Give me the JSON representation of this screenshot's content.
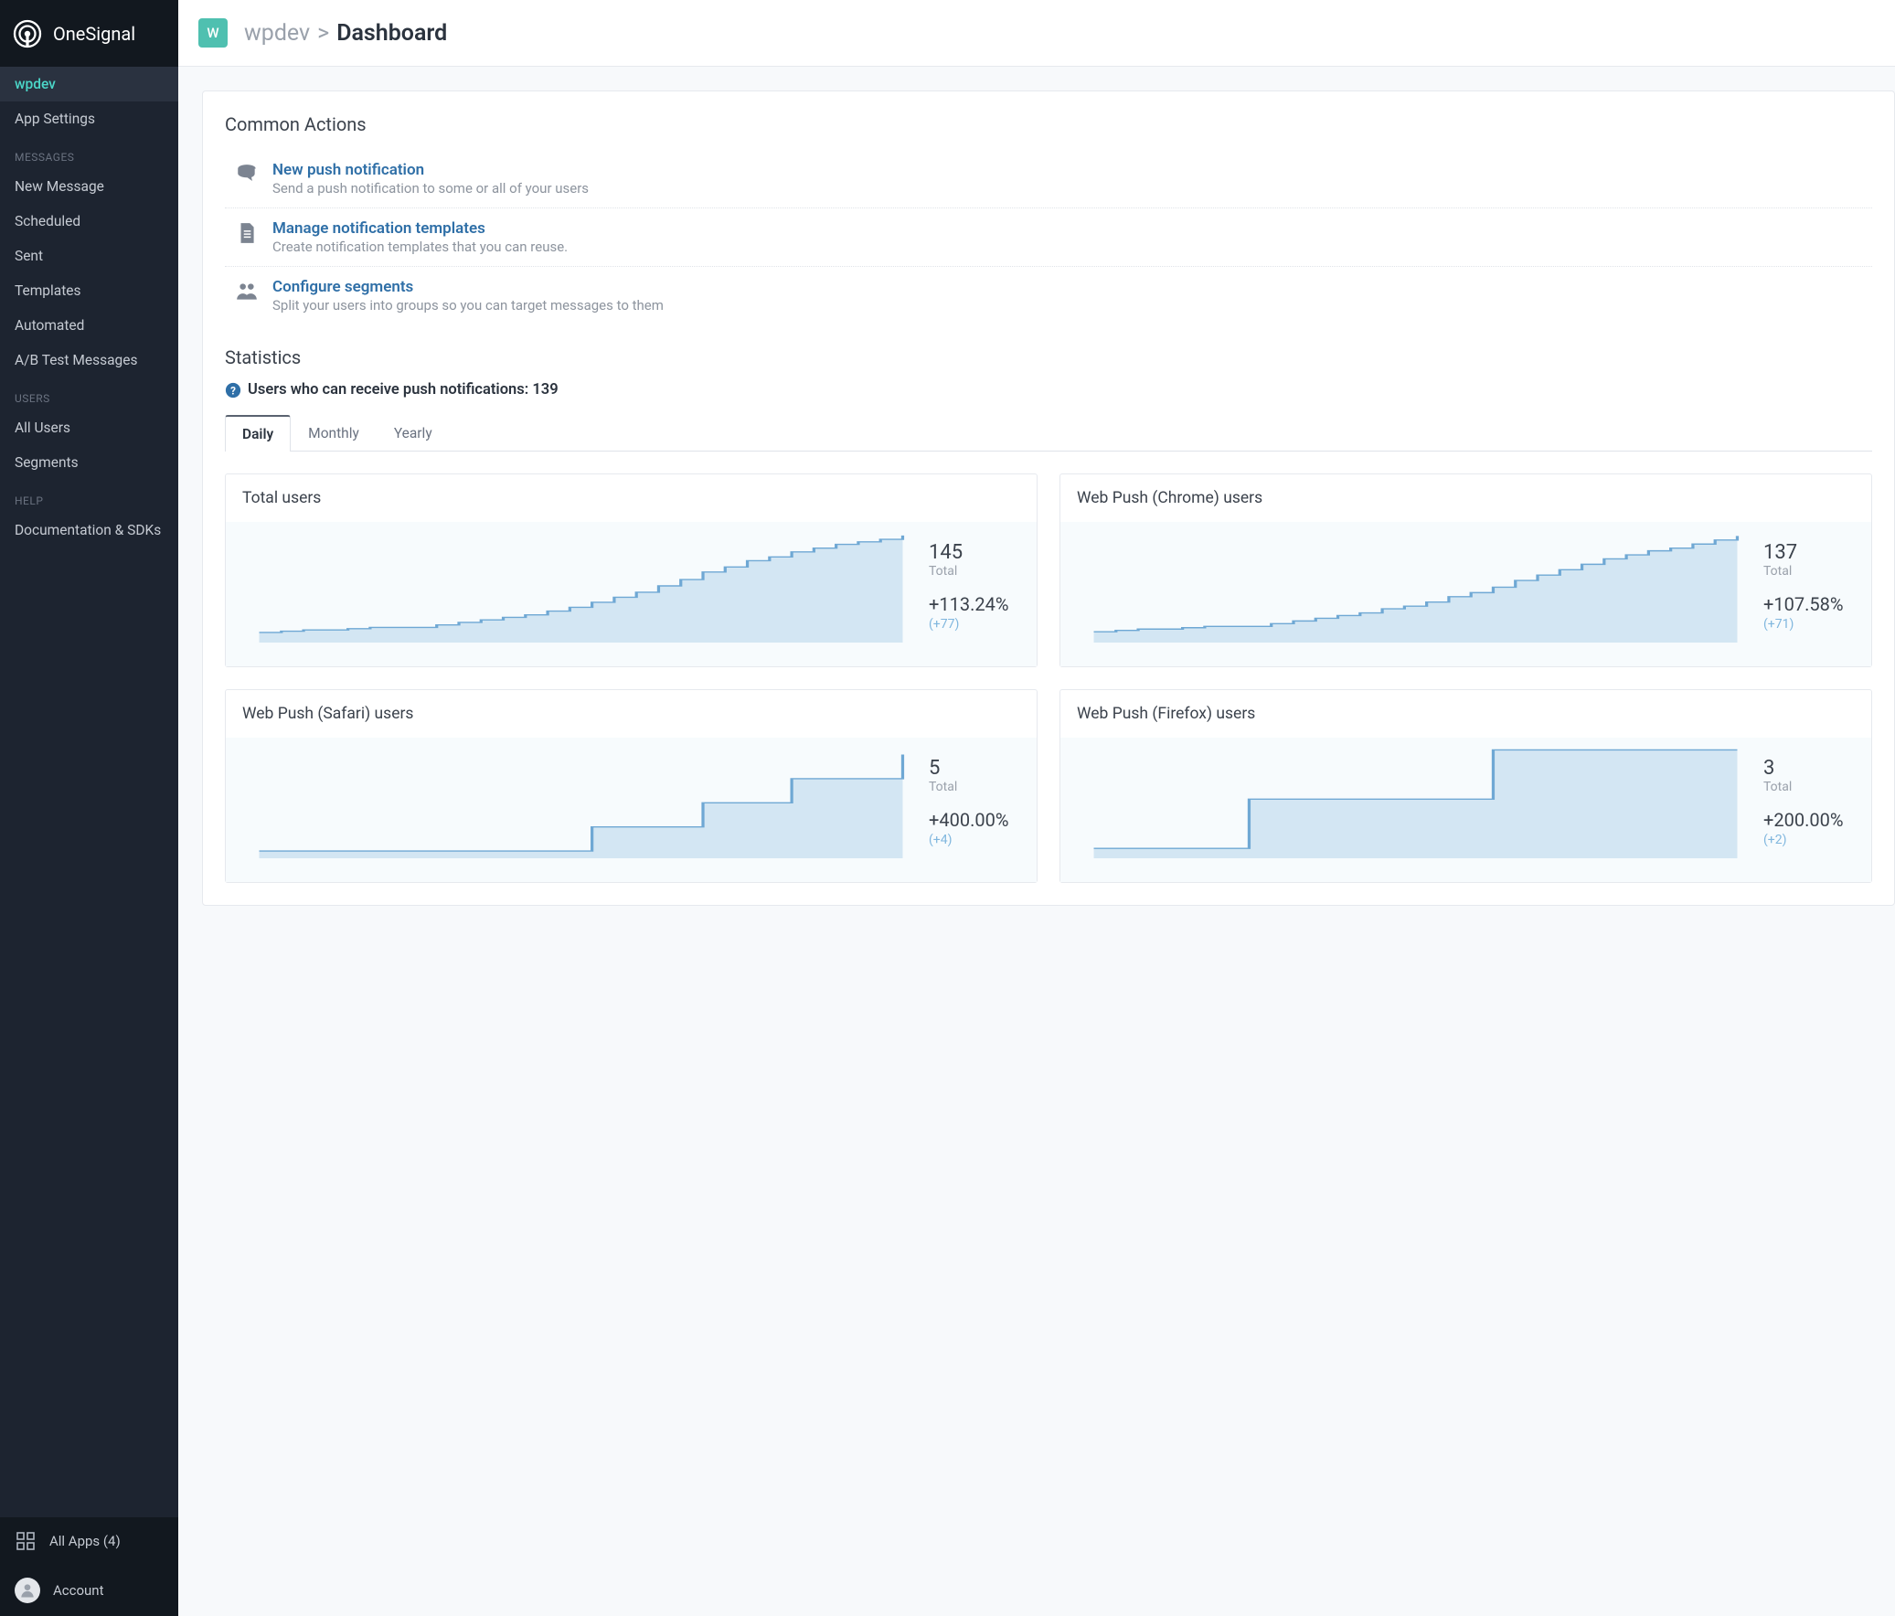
{
  "brand": "OneSignal",
  "sidebar": {
    "active_app": "wpdev",
    "app_settings": "App Settings",
    "sections": [
      {
        "heading": "MESSAGES",
        "items": [
          "New Message",
          "Scheduled",
          "Sent",
          "Templates",
          "Automated",
          "A/B Test Messages"
        ]
      },
      {
        "heading": "USERS",
        "items": [
          "All Users",
          "Segments"
        ]
      },
      {
        "heading": "HELP",
        "items": [
          "Documentation & SDKs"
        ]
      }
    ],
    "all_apps_label": "All Apps (4)",
    "account_label": "Account"
  },
  "breadcrumb": {
    "badge": "W",
    "app": "wpdev",
    "page": "Dashboard"
  },
  "common_actions": {
    "title": "Common Actions",
    "items": [
      {
        "title": "New push notification",
        "desc": "Send a push notification to some or all of your users"
      },
      {
        "title": "Manage notification templates",
        "desc": "Create notification templates that you can reuse."
      },
      {
        "title": "Configure segments",
        "desc": "Split your users into groups so you can target messages to them"
      }
    ]
  },
  "statistics": {
    "title": "Statistics",
    "receive_line_prefix": "Users who can receive push notifications: ",
    "receive_count": "139",
    "tabs": [
      "Daily",
      "Monthly",
      "Yearly"
    ],
    "active_tab": 0,
    "cards": [
      {
        "title": "Total users",
        "value": "145",
        "value_label": "Total",
        "percent": "+113.24%",
        "delta": "(+77)"
      },
      {
        "title": "Web Push (Chrome) users",
        "value": "137",
        "value_label": "Total",
        "percent": "+107.58%",
        "delta": "(+71)"
      },
      {
        "title": "Web Push (Safari) users",
        "value": "5",
        "value_label": "Total",
        "percent": "+400.00%",
        "delta": "(+4)"
      },
      {
        "title": "Web Push (Firefox) users",
        "value": "3",
        "value_label": "Total",
        "percent": "+200.00%",
        "delta": "(+2)"
      }
    ]
  },
  "chart_data": [
    {
      "type": "area",
      "title": "Total users",
      "y": [
        68,
        69,
        70,
        70,
        71,
        72,
        72,
        72,
        74,
        76,
        78,
        80,
        82,
        85,
        88,
        92,
        96,
        100,
        105,
        110,
        116,
        120,
        125,
        128,
        132,
        135,
        138,
        140,
        142,
        145
      ],
      "ylim": [
        60,
        150
      ]
    },
    {
      "type": "area",
      "title": "Web Push (Chrome) users",
      "y": [
        66,
        67,
        68,
        68,
        69,
        70,
        70,
        70,
        72,
        74,
        76,
        78,
        80,
        83,
        85,
        88,
        92,
        95,
        99,
        104,
        108,
        112,
        116,
        120,
        123,
        126,
        128,
        131,
        134,
        137
      ],
      "ylim": [
        58,
        142
      ]
    },
    {
      "type": "area",
      "title": "Web Push (Safari) users",
      "y": [
        1,
        1,
        1,
        1,
        1,
        1,
        1,
        1,
        1,
        1,
        1,
        1,
        1,
        1,
        1,
        2,
        2,
        2,
        2,
        2,
        3,
        3,
        3,
        3,
        4,
        4,
        4,
        4,
        4,
        5
      ],
      "ylim": [
        0.7,
        5.4
      ]
    },
    {
      "type": "area",
      "title": "Web Push (Firefox) users",
      "y": [
        1,
        1,
        1,
        1,
        1,
        1,
        1,
        2,
        2,
        2,
        2,
        2,
        2,
        2,
        2,
        2,
        2,
        2,
        3,
        3,
        3,
        3,
        3,
        3,
        3,
        3,
        3,
        3,
        3,
        3
      ],
      "ylim": [
        0.8,
        3.1
      ]
    }
  ]
}
